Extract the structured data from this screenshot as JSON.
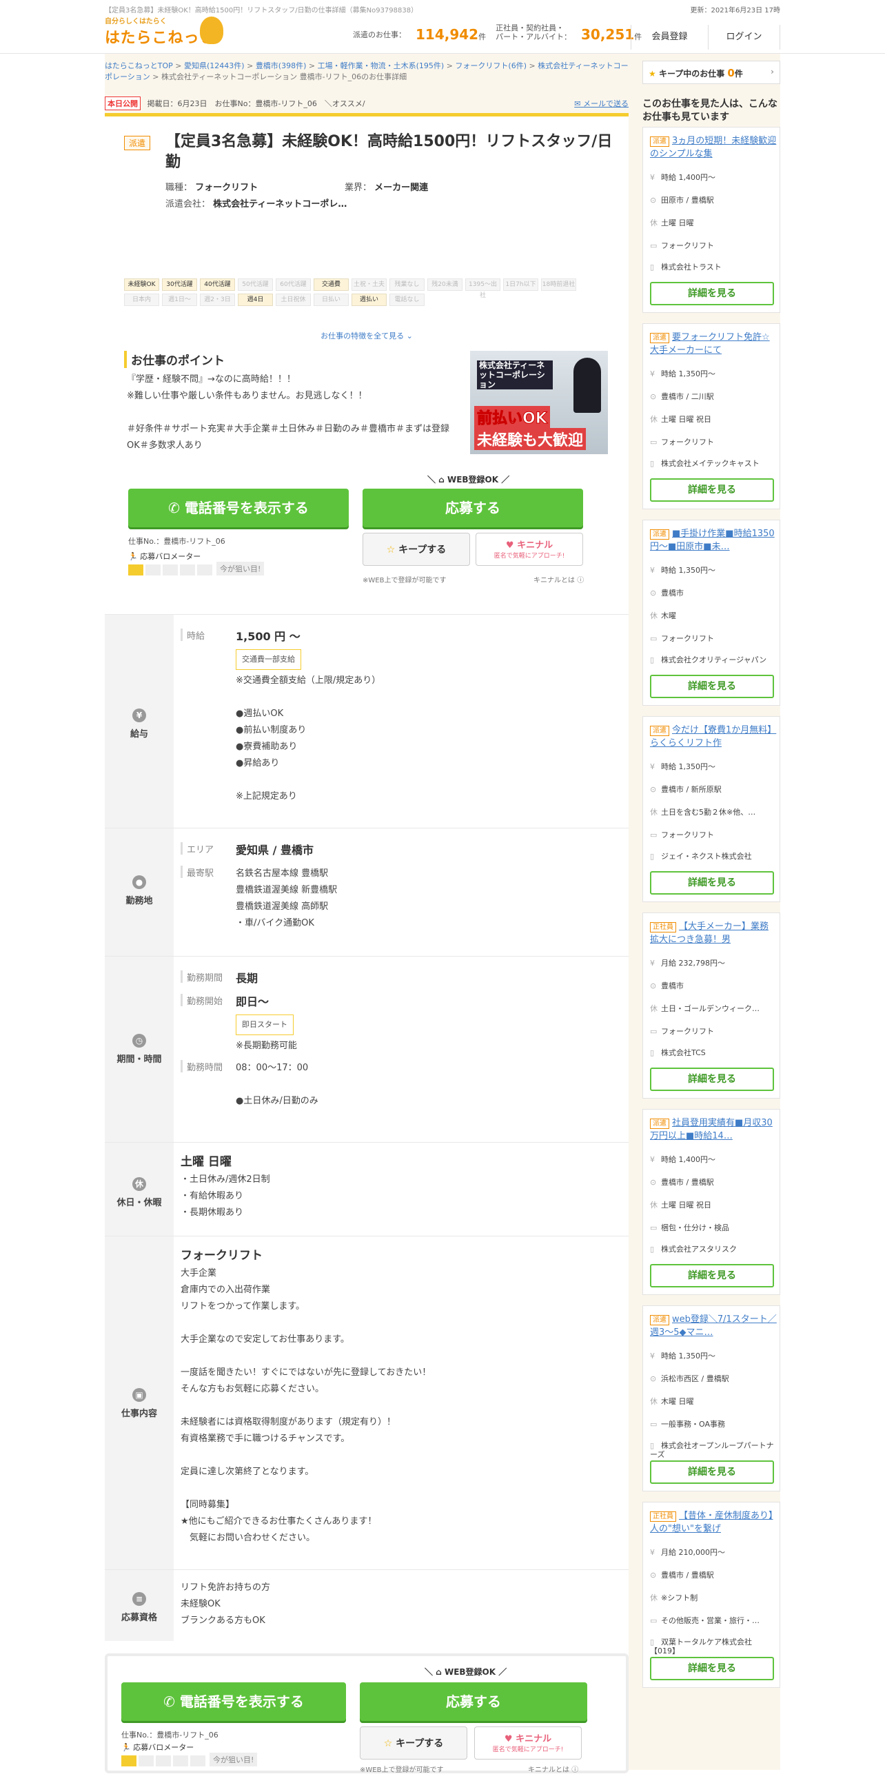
{
  "top": {
    "seo": "【定員3名急募】未経験OK！高時給1500円！リフトスタッフ/日勤の仕事詳細（募集No93798838）",
    "updated": "更新：2021年6月23日 17時",
    "logo_tag": "自分らしくはたらく",
    "logo_name": "はたらこねっと",
    "haken_label": "派遣のお仕事：",
    "haken_count": "114,942",
    "unit": "件",
    "seishain_label1": "正社員・契約社員・",
    "seishain_label2": "パート・アルバイト：",
    "seishain_count": "30,251",
    "register": "会員登録",
    "login": "ログイン"
  },
  "breadcrumb": {
    "items": [
      "はたらこねっとTOP",
      "愛知県(12443件)",
      "豊橋市(398件)",
      "工場・軽作業・物流・土木系(195件)",
      "フォークリフト(6件)",
      "株式会社ティーネットコーポレーション"
    ],
    "current": "株式会社ティーネットコーポレーション 豊橋市-リフト_06のお仕事詳細"
  },
  "pub": {
    "badge": "本日公開",
    "info": "掲載日：6月23日　お仕事No：豊橋市-リフト_06　＼オススメ/",
    "mail": "メールで送る"
  },
  "job": {
    "type": "派遣",
    "title": "【定員3名急募】未経験OK！高時給1500円！リフトスタッフ/日勤",
    "occ_label": "職種：",
    "occ": "フォークリフト",
    "ind_label": "業界：",
    "ind": "メーカー関連",
    "co_label": "派遣会社：",
    "co": "株式会社ティーネットコーポレ…"
  },
  "tags": [
    {
      "t": "未経験OK",
      "on": true
    },
    {
      "t": "30代活躍",
      "on": true
    },
    {
      "t": "40代活躍",
      "on": true
    },
    {
      "t": "50代活躍",
      "on": false
    },
    {
      "t": "60代活躍",
      "on": false
    },
    {
      "t": "交通費",
      "on": true
    },
    {
      "t": "土祝・土夫",
      "on": false
    },
    {
      "t": "残業なし",
      "on": false
    },
    {
      "t": "残20未満",
      "on": false
    },
    {
      "t": "1395～出社",
      "on": false
    },
    {
      "t": "1日7h以下",
      "on": false
    },
    {
      "t": "18時前退社",
      "on": false
    },
    {
      "t": "日本内",
      "on": false
    },
    {
      "t": "週1日～",
      "on": false
    },
    {
      "t": "週2・3日",
      "on": false
    },
    {
      "t": "週4日",
      "on": true
    },
    {
      "t": "土日祝休",
      "on": false
    },
    {
      "t": "日払い",
      "on": false
    },
    {
      "t": "週払い",
      "on": true
    },
    {
      "t": "電話なし",
      "on": false
    }
  ],
  "more_features": "お仕事の特徴を全て見る",
  "point": {
    "heading": "お仕事のポイント",
    "text": "『学歴・経験不問』→なのに高時給！！！\n※難しい仕事や厳しい条件もありません。お見逃しなく！！\n\n＃好条件＃サポート充実＃大手企業＃土日休み＃日勤のみ＃豊橋市＃まずは登録OK＃多数求人あり",
    "photo_l1": "株式会社ティーネットコーポレーション",
    "photo_l2": "前払いOK",
    "photo_l3": "未経験も大歓迎"
  },
  "cta": {
    "web": "WEB登録OK",
    "phone": "電話番号を表示する",
    "apply": "応募する",
    "jobno": "仕事No.：豊橋市-リフト_06",
    "meter": "応募バロメーター",
    "now": "今が狙い目!",
    "keep": "キープする",
    "kini": "キニナル",
    "kini_sub": "匿名で気軽にアプローチ!",
    "web_note": "※WEB上で登録が可能です",
    "kini_what": "キニナルとは"
  },
  "pay": {
    "head": "給与",
    "lbl": "時給",
    "val": "1,500 円 ～",
    "badge": "交通費一部支給",
    "detail": "※交通費全額支給（上限/規定あり）\n\n●週払いOK\n●前払い制度あり\n●寮費補助あり\n●昇給あり\n\n※上記規定あり"
  },
  "loc": {
    "head": "勤務地",
    "area_lbl": "エリア",
    "area": "愛知県 / 豊橋市",
    "st_lbl": "最寄駅",
    "st": "名鉄名古屋本線 豊橋駅\n豊橋鉄道渥美線 新豊橋駅\n豊橋鉄道渥美線 高師駅\n・車/バイク通勤OK"
  },
  "period": {
    "head": "期間・時間",
    "p_lbl": "勤務期間",
    "p": "長期",
    "s_lbl": "勤務開始",
    "s": "即日～",
    "badge": "即日スタート",
    "note": "※長期勤務可能",
    "t_lbl": "勤務時間",
    "t": "08：00～17：00\n\n●土日休み/日勤のみ"
  },
  "hol": {
    "head": "休日・休暇",
    "big": "土曜 日曜",
    "text": "・土日休み/週休2日制\n・有給休暇あり\n・長期休暇あり"
  },
  "work": {
    "head": "仕事内容",
    "big": "フォークリフト",
    "text": "大手企業\n倉庫内での入出荷作業\nリフトをつかって作業します。\n\n大手企業なので安定してお仕事あります。\n\n一度話を聞きたい！すぐにではないが先に登録しておきたい！\nそんな方もお気軽に応募ください。\n\n未経験者には資格取得制度があります（規定有り）！\n有資格業務で手に職つけるチャンスです。\n\n定員に達し次第終了となります。\n\n【同時募集】\n★他にもご紹介できるお仕事たくさんあります！\n　気軽にお問い合わせください。"
  },
  "qual": {
    "head": "応募資格",
    "text": "リフト免許お持ちの方\n未経験OK\nブランクある方もOK"
  },
  "side": {
    "keep": "キープ中のお仕事",
    "keep_n": "0",
    "keep_unit": "件",
    "title": "このお仕事を見た人は、こんなお仕事も見ています",
    "detail": "詳細を見る",
    "cards": [
      {
        "k": "派遣",
        "t": "3ヵ月の短期！未経験歓迎のシンプルな集",
        "pay": "時給 1,400円～",
        "loc": "田原市 / 豊橋駅",
        "hol": "土曜 日曜",
        "job": "フォークリフト",
        "co": "株式会社トラスト"
      },
      {
        "k": "派遣",
        "t": "要フォークリフト免許☆大手メーカーにて",
        "pay": "時給 1,350円～",
        "loc": "豊橋市 / 二川駅",
        "hol": "土曜 日曜 祝日",
        "job": "フォークリフト",
        "co": "株式会社メイテックキャスト"
      },
      {
        "k": "派遣",
        "t": "■手掛け作業■時給1350円～■田原市■未…",
        "pay": "時給 1,350円～",
        "loc": "豊橋市",
        "hol": "木曜",
        "job": "フォークリフト",
        "co": "株式会社クオリティージャパン"
      },
      {
        "k": "派遣",
        "t": "今だけ【寮費1か月無料】らくらくリフト作",
        "pay": "時給 1,350円～",
        "loc": "豊橋市 / 新所原駅",
        "hol": "土日を含む5勤２休※他、…",
        "job": "フォークリフト",
        "co": "ジェイ・ネクスト株式会社"
      },
      {
        "k": "正社員",
        "t": "【大手メーカー】業務拡大につき急募！男",
        "pay": "月給 232,798円～",
        "loc": "豊橋市",
        "hol": "土日・ゴールデンウィーク…",
        "job": "フォークリフト",
        "co": "株式会社TCS"
      },
      {
        "k": "派遣",
        "t": "社員登用実績有■月収30万円以上■時給14…",
        "pay": "時給 1,400円～",
        "loc": "豊橋市 / 豊橋駅",
        "hol": "土曜 日曜 祝日",
        "job": "梱包・仕分け・検品",
        "co": "株式会社アスタリスク"
      },
      {
        "k": "派遣",
        "t": "web登録＼7/1スタート／週3～5◆マニ…",
        "pay": "時給 1,350円～",
        "loc": "浜松市西区 / 豊橋駅",
        "hol": "木曜 日曜",
        "job": "一般事務・OA事務",
        "co": "株式会社オープンループパートナーズ"
      },
      {
        "k": "正社員",
        "t": "【昔体・産休制度あり】人の\"想い\"を繋げ",
        "pay": "月給 210,000円～",
        "loc": "豊橋市 / 豊橋駅",
        "hol": "※シフト制",
        "job": "その他販売・営業・旅行・…",
        "co": "双葉トータルケア株式会社【019】"
      }
    ]
  }
}
